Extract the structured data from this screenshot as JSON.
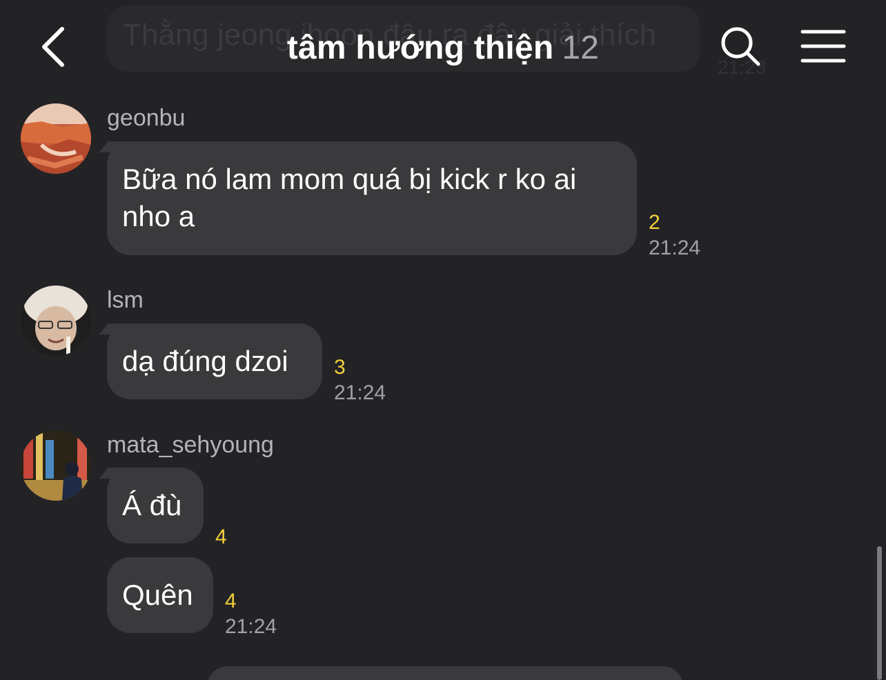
{
  "header": {
    "title": "tâm hướng thiện",
    "member_count": "12",
    "ghost_message": "Thằng jeong ihoon đâu ra đây giải thích",
    "ghost_time": "21:23"
  },
  "messages": [
    {
      "sender": "geonbu",
      "avatar": "canyon-photo",
      "bubbles": [
        {
          "text": "Bữa nó lam mom quá bị kick r ko ai nho a",
          "unread": "2",
          "time": "21:24"
        }
      ]
    },
    {
      "sender": "lsm",
      "avatar": "person-hat-photo",
      "bubbles": [
        {
          "text": "dạ đúng dzoi",
          "unread": "3",
          "time": "21:24"
        }
      ]
    },
    {
      "sender": "mata_sehyoung",
      "avatar": "city-night-photo",
      "bubbles": [
        {
          "text": "Á đù",
          "unread": "4",
          "time": ""
        },
        {
          "text": "Quên",
          "unread": "4",
          "time": "21:24"
        }
      ]
    }
  ],
  "colors": {
    "background": "#232326",
    "bubble": "#3a3a3d",
    "unread": "#f3d03a",
    "secondary_text": "#a3a3a7"
  }
}
